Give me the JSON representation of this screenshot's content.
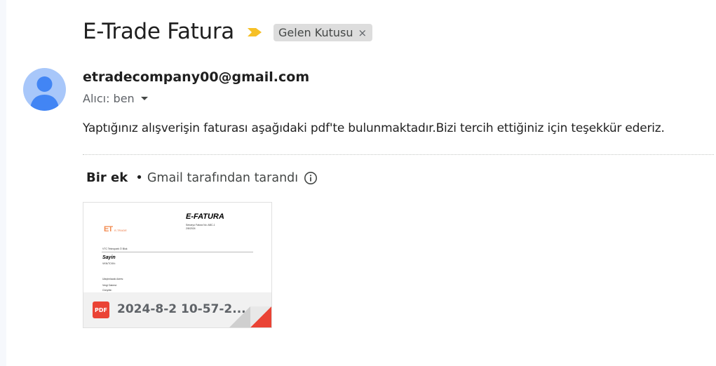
{
  "email": {
    "subject": "E-Trade Fatura",
    "label": "Gelen Kutusu",
    "label_remove": "×",
    "sender": "etradecompany00@gmail.com",
    "to_line": "Alıcı: ben",
    "body": "Yaptığınız alışverişin faturası aşağıdaki pdf'te bulunmaktadır.Bizi tercih ettiğiniz için teşekkür ederiz."
  },
  "attachments": {
    "count_label": "Bir ek",
    "separator": "•",
    "scan_text": "Gmail tarafından tarandı",
    "items": [
      {
        "name": "2024-8-2 10-57-2...",
        "type_badge": "PDF",
        "preview": {
          "title": "E-FATURA",
          "logo": "ET",
          "logo_sub": "E-TRADE",
          "meta_line1": "Senaryo Fatura No: ABC-1",
          "meta_line2": "2/8/2024",
          "section": "VTC Teknopark Ö Blok",
          "greeting": "Sayin",
          "greeting_sub": "VKN/TCKN:",
          "field1": "Ulaştırılacak Adres:",
          "field2": "Vergi Dairesi:",
          "field3": "Cünyilte:"
        }
      }
    ]
  },
  "colors": {
    "avatar_bg": "#a8c7fa",
    "avatar_fg": "#4285f4",
    "important": "#f6c026",
    "pdf_red": "#ea4335"
  }
}
